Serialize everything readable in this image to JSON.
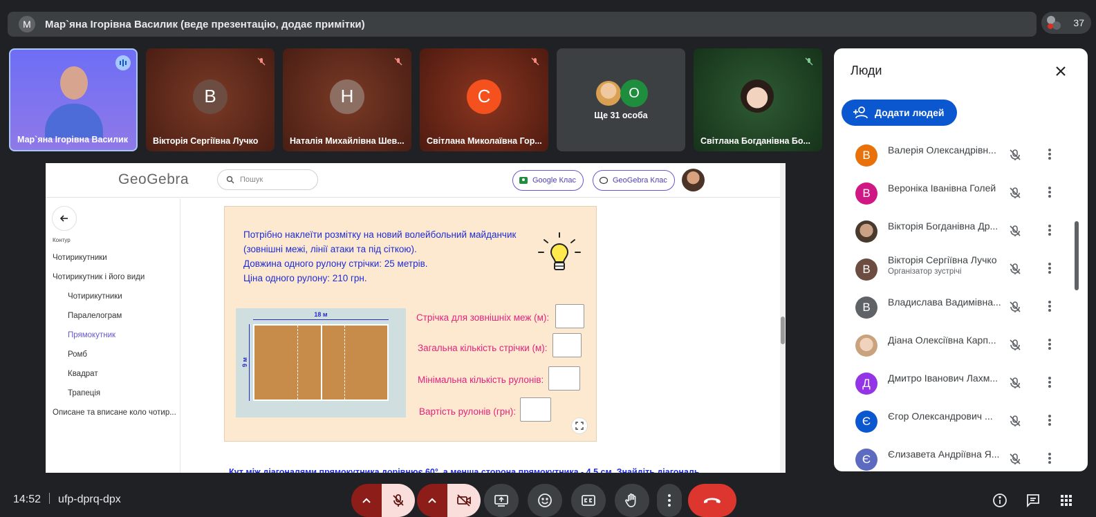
{
  "banner": {
    "initial": "M",
    "text": "Мар`яна Ігорівна Василик (веде презентацію, додає примітки)"
  },
  "participants_count": "37",
  "tiles": [
    {
      "name": "Мар`яна Ігорівна Василик"
    },
    {
      "initial": "B",
      "name": "Вікторія Сергіївна Лучко"
    },
    {
      "initial": "Н",
      "name": "Наталія Михайлівна Шев..."
    },
    {
      "initial": "С",
      "name": "Світлана Миколаївна Гор..."
    },
    {
      "initial": "О",
      "name": "Ще 31 особа"
    },
    {
      "name": "Світлана Богданівна Бо..."
    }
  ],
  "geogebra": {
    "logo": "GeoGebra",
    "search_placeholder": "Пошук",
    "btn_google": "Google Клас",
    "btn_geogebra": "GeoGebra Клас",
    "side_caption": "Контур",
    "side_items": [
      "Чотирикутники",
      "Чотирикутник і його види",
      "Чотирикутники",
      "Паралелограм",
      "Прямокутник",
      "Ромб",
      "Квадрат",
      "Трапеція",
      "Описане та вписане коло чотир..."
    ],
    "task_lines": [
      "Потрібно наклеїти розмітку на новий волейбольний майданчик",
      "(зовнішні межі, лінії атаки та під сіткою).",
      "Довжина одного рулону стрічки: 25 метрів.",
      "Ціна одного рулону: 210 грн."
    ],
    "court_width_label": "18 м",
    "court_height_label": "9 м",
    "questions": [
      "Стрічка для зовнішніх меж (м):",
      "Загальна кількість стрічки (м):",
      "Мінімальна кількість рулонів:",
      "Вартість рулонів (грн):"
    ],
    "next_task": "Кут між діагоналями прямокутника дорівнює 60°, а менша сторона прямокутника - 4,5 см. Знайдіть діагональ."
  },
  "people": {
    "title": "Люди",
    "add_button": "Додати людей",
    "list": [
      {
        "initial": "B",
        "name": "Валерія Олександрівн...",
        "color": "#e8710a"
      },
      {
        "initial": "B",
        "name": "Вероніка Іванівна Голей",
        "color": "#d01884"
      },
      {
        "initial": "",
        "name": "Вікторія Богданівна Др...",
        "color": "#7a5a3e"
      },
      {
        "initial": "B",
        "name": "Вікторія Сергіївна Лучко",
        "role": "Організатор зустрічі",
        "color": "#6d4c41"
      },
      {
        "initial": "B",
        "name": "Владислава Вадимівна...",
        "color": "#5f6368"
      },
      {
        "initial": "",
        "name": "Діана Олексіївна Карп...",
        "color": "#c9a37e"
      },
      {
        "initial": "Д",
        "name": "Дмитро Іванович Лахм...",
        "color": "#9334e6"
      },
      {
        "initial": "Є",
        "name": "Єгор Олександрович ...",
        "color": "#0b57d0"
      },
      {
        "initial": "Є",
        "name": "Єлизавета Андріївна Я...",
        "color": "#5c6bc0"
      }
    ]
  },
  "bottom": {
    "time": "14:52",
    "meeting_code": "ufp-dprq-dpx"
  }
}
